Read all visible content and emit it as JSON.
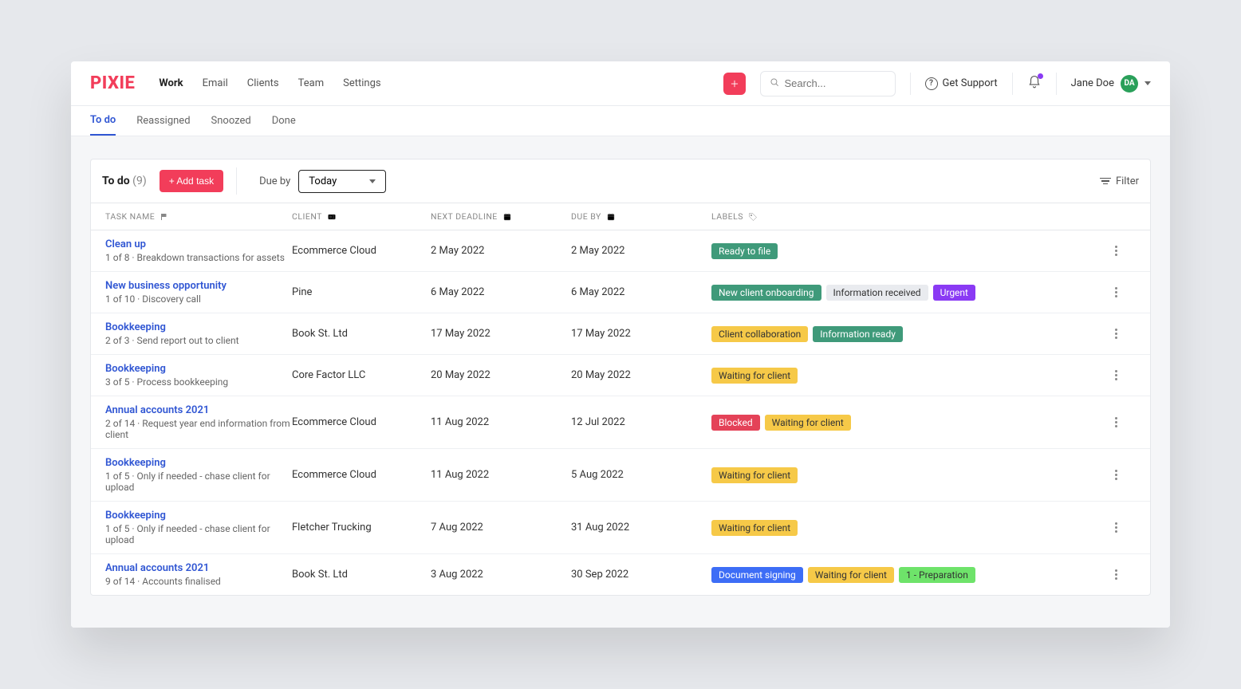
{
  "brand": "PIXIE",
  "nav": {
    "items": [
      "Work",
      "Email",
      "Clients",
      "Team",
      "Settings"
    ],
    "active_index": 0
  },
  "search": {
    "placeholder": "Search..."
  },
  "support_label": "Get Support",
  "user": {
    "name": "Jane Doe",
    "initials": "DA"
  },
  "subtabs": {
    "items": [
      "To do",
      "Reassigned",
      "Snoozed",
      "Done"
    ],
    "active_index": 0
  },
  "toolbar": {
    "title": "To do",
    "count": "(9)",
    "add_task_label": "+ Add task",
    "due_by_label": "Due by",
    "due_by_value": "Today",
    "filter_label": "Filter"
  },
  "columns": {
    "task": "TASK NAME",
    "client": "CLIENT",
    "next_deadline": "NEXT DEADLINE",
    "due_by": "DUE BY",
    "labels": "LABELS"
  },
  "label_colors": {
    "Ready to file": {
      "bg": "#3F9A7A",
      "fg": "#fff"
    },
    "New client onboarding": {
      "bg": "#3F9A7A",
      "fg": "#fff"
    },
    "Information received": {
      "bg": "#E9EBEF",
      "fg": "#333"
    },
    "Urgent": {
      "bg": "#8A3AF4",
      "fg": "#fff"
    },
    "Client collaboration": {
      "bg": "#F6C948",
      "fg": "#333"
    },
    "Information ready": {
      "bg": "#3F9A7A",
      "fg": "#fff"
    },
    "Waiting for client": {
      "bg": "#F6C948",
      "fg": "#333"
    },
    "Blocked": {
      "bg": "#E44258",
      "fg": "#fff"
    },
    "Document signing": {
      "bg": "#3D6DF6",
      "fg": "#fff"
    },
    "1 - Preparation": {
      "bg": "#6EE36A",
      "fg": "#333"
    }
  },
  "tasks": [
    {
      "name": "Clean up",
      "sub": "1 of 8 · Breakdown transactions for assets",
      "client": "Ecommerce Cloud",
      "next_deadline": "2 May 2022",
      "due_by": "2 May 2022",
      "labels": [
        "Ready to file"
      ]
    },
    {
      "name": "New business opportunity",
      "sub": "1 of 10 · Discovery call",
      "client": "Pine",
      "next_deadline": "6 May 2022",
      "due_by": "6 May 2022",
      "labels": [
        "New client onboarding",
        "Information received",
        "Urgent"
      ]
    },
    {
      "name": "Bookkeeping",
      "sub": "2 of 3 · Send report out to client",
      "client": "Book St. Ltd",
      "next_deadline": "17 May 2022",
      "due_by": "17 May 2022",
      "labels": [
        "Client collaboration",
        "Information ready"
      ]
    },
    {
      "name": "Bookkeeping",
      "sub": "3 of 5 · Process bookkeeping",
      "client": "Core Factor LLC",
      "next_deadline": "20 May 2022",
      "due_by": "20 May 2022",
      "labels": [
        "Waiting for client"
      ]
    },
    {
      "name": "Annual accounts 2021",
      "sub": "2 of 14 · Request year end information from client",
      "client": "Ecommerce Cloud",
      "next_deadline": "11 Aug 2022",
      "due_by": "12 Jul 2022",
      "labels": [
        "Blocked",
        "Waiting for client"
      ]
    },
    {
      "name": "Bookkeeping",
      "sub": "1 of 5 · Only if needed - chase client for upload",
      "client": "Ecommerce Cloud",
      "next_deadline": "11 Aug 2022",
      "due_by": "5 Aug 2022",
      "labels": [
        "Waiting for client"
      ]
    },
    {
      "name": "Bookkeeping",
      "sub": "1 of 5 · Only if needed - chase client for upload",
      "client": "Fletcher Trucking",
      "next_deadline": "7 Aug 2022",
      "due_by": "31 Aug 2022",
      "labels": [
        "Waiting for client"
      ]
    },
    {
      "name": "Annual accounts 2021",
      "sub": "9 of 14 · Accounts finalised",
      "client": "Book St. Ltd",
      "next_deadline": "3 Aug 2022",
      "due_by": "30 Sep 2022",
      "labels": [
        "Document signing",
        "Waiting for client",
        "1 - Preparation"
      ]
    }
  ]
}
